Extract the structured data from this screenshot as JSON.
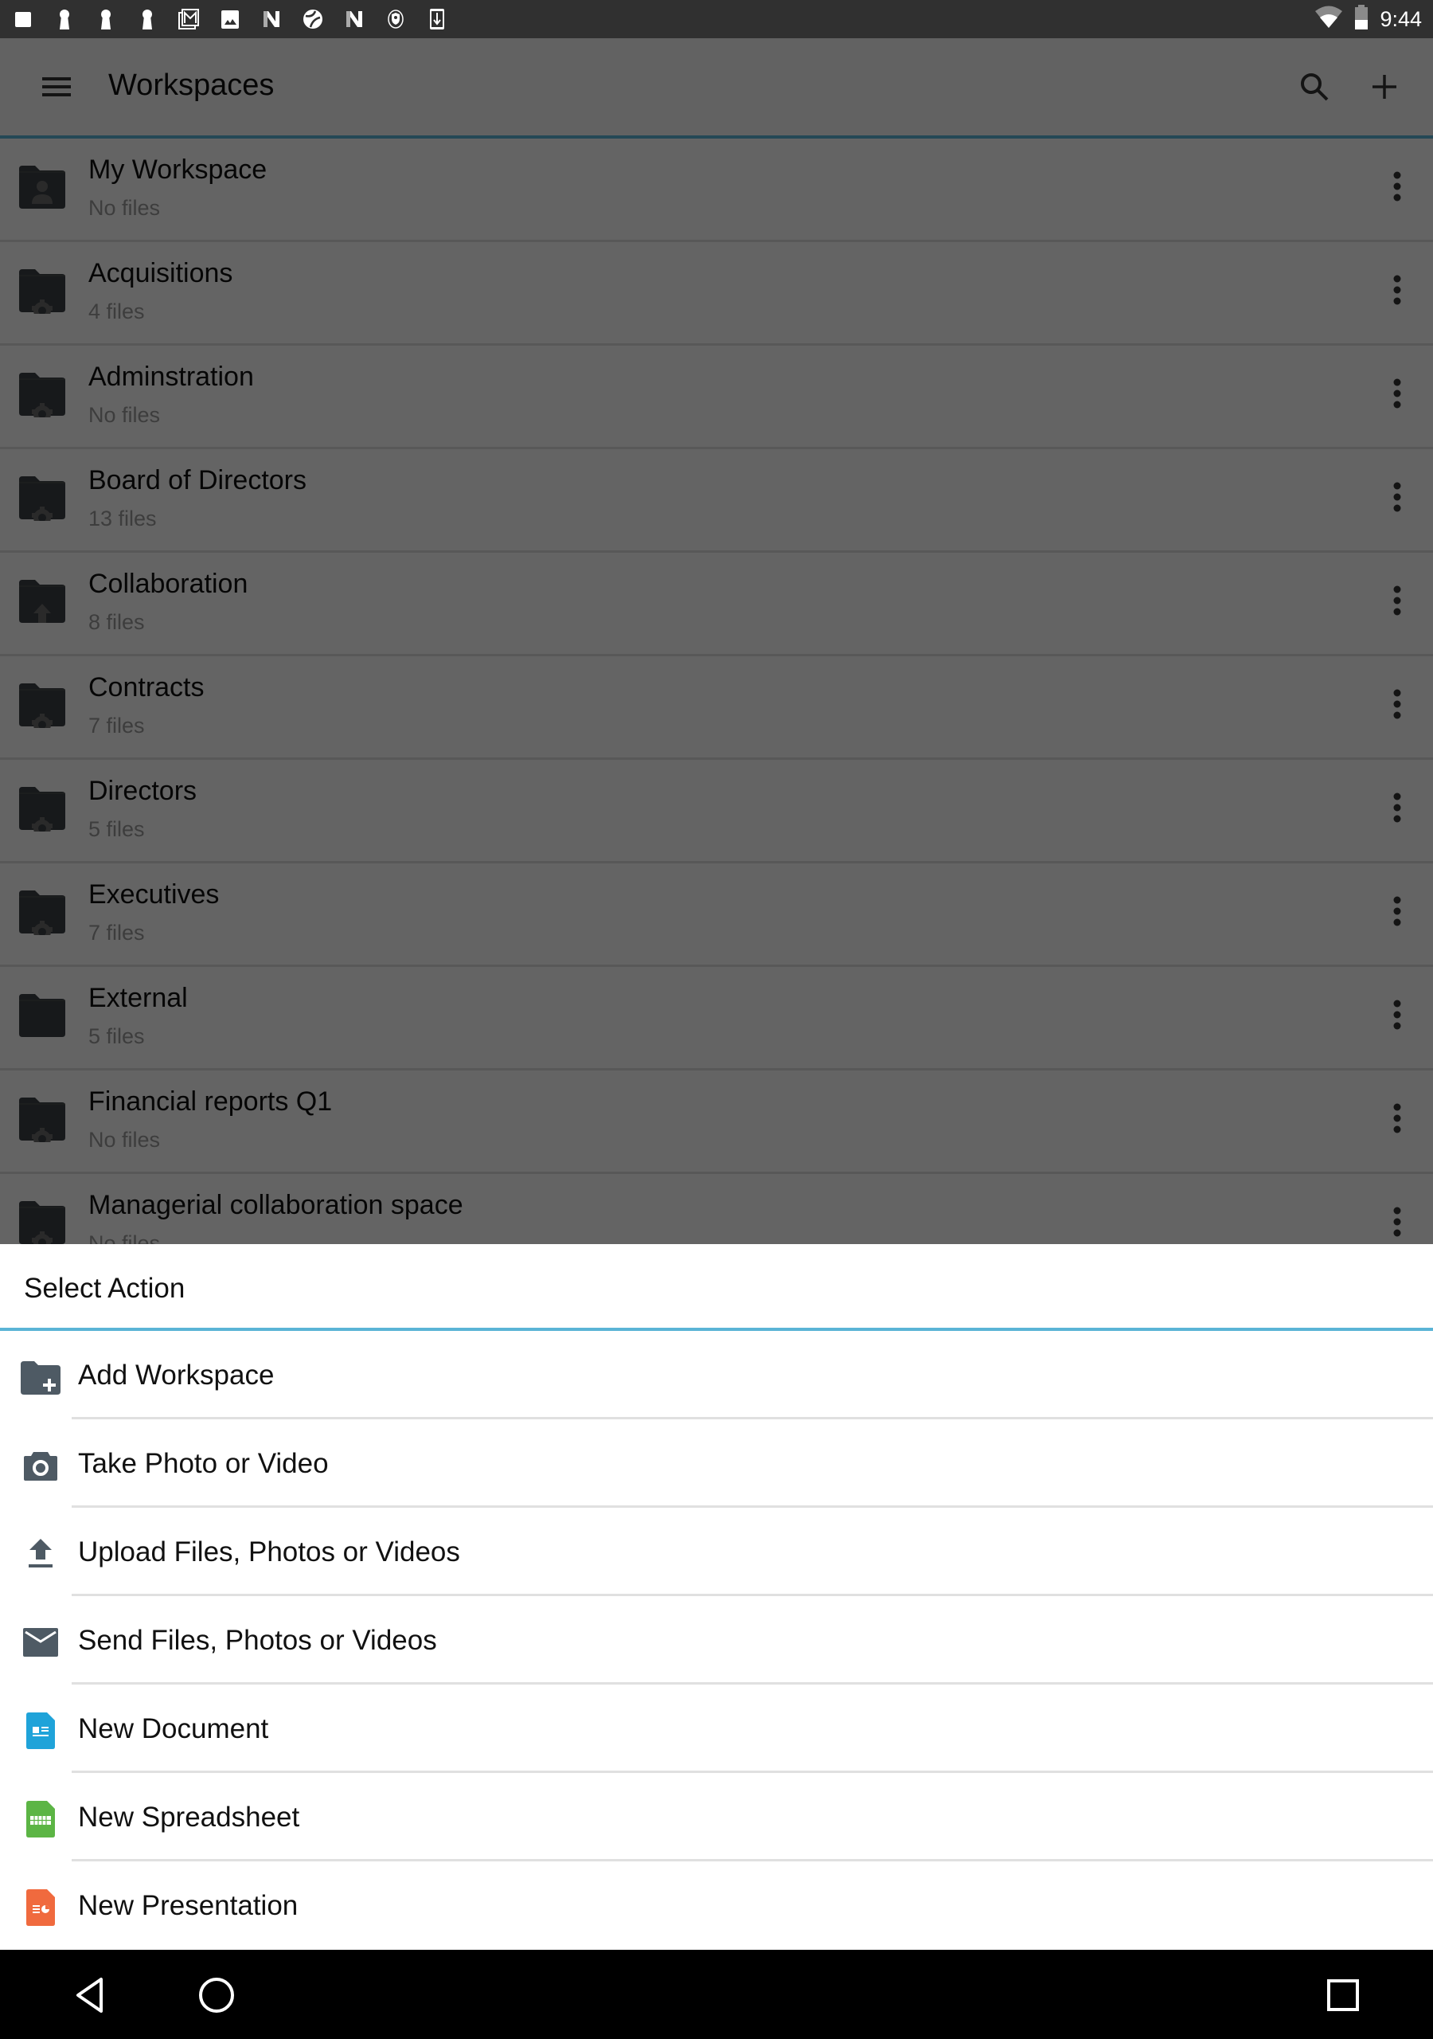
{
  "status_bar": {
    "notification_icons": [
      "notification-square-icon",
      "keyhole-icon",
      "keyhole-icon",
      "keyhole-icon",
      "gmail-icon",
      "photo-icon",
      "n-app-icon",
      "aperture-icon",
      "n-app-icon",
      "shield-icon",
      "download-icon"
    ],
    "wifi": "wifi-icon",
    "battery": "battery-icon",
    "time": "9:44"
  },
  "app_bar": {
    "title": "Workspaces",
    "menu_icon": "hamburger-menu-icon",
    "search_icon": "search-icon",
    "add_icon": "add-icon"
  },
  "workspaces": [
    {
      "name": "My Workspace",
      "files": "No files",
      "icon": "personal-folder-icon"
    },
    {
      "name": "Acquisitions",
      "files": "4 files",
      "icon": "shared-folder-icon"
    },
    {
      "name": "Adminstration",
      "files": "No files",
      "icon": "shared-folder-icon"
    },
    {
      "name": "Board of Directors",
      "files": "13 files",
      "icon": "shared-folder-icon"
    },
    {
      "name": "Collaboration",
      "files": "8 files",
      "icon": "upload-folder-icon"
    },
    {
      "name": "Contracts",
      "files": "7 files",
      "icon": "shared-folder-icon"
    },
    {
      "name": "Directors",
      "files": "5 files",
      "icon": "shared-folder-icon"
    },
    {
      "name": "Executives",
      "files": "7 files",
      "icon": "shared-folder-icon"
    },
    {
      "name": "External",
      "files": "5 files",
      "icon": "folder-icon"
    },
    {
      "name": "Financial reports Q1",
      "files": "No files",
      "icon": "shared-folder-icon"
    },
    {
      "name": "Managerial collaboration space",
      "files": "No files",
      "icon": "shared-folder-icon"
    }
  ],
  "sheet": {
    "title": "Select Action",
    "actions": [
      {
        "label": "Add Workspace",
        "icon": "add-folder-icon"
      },
      {
        "label": "Take Photo or Video",
        "icon": "camera-icon"
      },
      {
        "label": "Upload Files, Photos or Videos",
        "icon": "upload-icon"
      },
      {
        "label": "Send Files, Photos or Videos",
        "icon": "mail-icon"
      },
      {
        "label": "New Document",
        "icon": "document-icon",
        "color": "#1fa3d9"
      },
      {
        "label": "New Spreadsheet",
        "icon": "spreadsheet-icon",
        "color": "#5cb545"
      },
      {
        "label": "New Presentation",
        "icon": "presentation-icon",
        "color": "#f06a3e"
      }
    ]
  },
  "colors": {
    "accent": "#5ab4d6",
    "icon_gray": "#4e5a64",
    "status_bar": "#303030"
  },
  "nav_bar": {
    "back": "back-icon",
    "home": "home-icon",
    "recents": "recents-icon"
  }
}
